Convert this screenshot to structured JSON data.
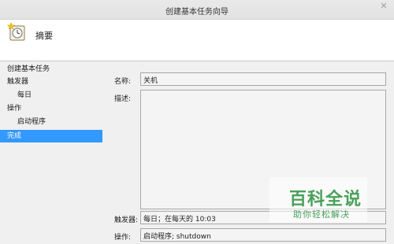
{
  "window": {
    "title": "创建基本任务向导",
    "close_glyph": "✕"
  },
  "header": {
    "icon": "task-clock-icon",
    "title": "摘要"
  },
  "nav": {
    "items": [
      {
        "label": "创建基本任务",
        "level": 1,
        "selected": false
      },
      {
        "label": "触发器",
        "level": 1,
        "selected": false
      },
      {
        "label": "每日",
        "level": 2,
        "selected": false
      },
      {
        "label": "操作",
        "level": 1,
        "selected": false
      },
      {
        "label": "启动程序",
        "level": 2,
        "selected": false
      },
      {
        "label": "完成",
        "level": 1,
        "selected": true
      }
    ],
    "selected_color": "#3399ff"
  },
  "summary": {
    "name_label": "名称:",
    "name_value": "关机",
    "desc_label": "描述:",
    "desc_value": "",
    "trigger_label": "触发器:",
    "trigger_value": "每日；在每天的 10:03",
    "action_label": "操作:",
    "action_value": "启动程序; shutdown"
  },
  "watermark": {
    "line1": "百科全说",
    "line2": "助你轻松解决",
    "color": "#49a15a"
  }
}
